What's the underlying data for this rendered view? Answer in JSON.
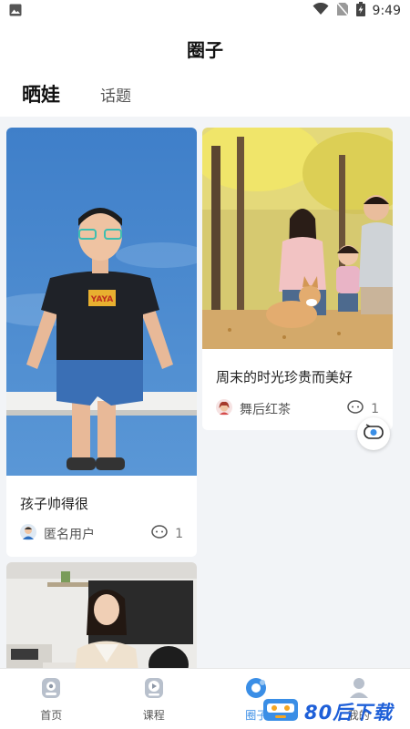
{
  "status_bar": {
    "time": "9:49"
  },
  "header": {
    "title": "圈子"
  },
  "tabs": [
    {
      "label": "晒娃",
      "active": true
    },
    {
      "label": "话题",
      "active": false
    }
  ],
  "posts": [
    {
      "caption": "孩子帅得很",
      "author": "匿名用户",
      "comment_count": "1",
      "shirt_text": "YAYA"
    },
    {
      "caption": "周末的时光珍贵而美好",
      "author": "舞后红茶",
      "comment_count": "1"
    }
  ],
  "bottom_nav": [
    {
      "label": "首页",
      "icon": "home-icon"
    },
    {
      "label": "课程",
      "icon": "course-play-icon"
    },
    {
      "label": "圈子",
      "icon": "circle-icon",
      "active": true
    },
    {
      "label": "我的",
      "icon": "profile-icon"
    }
  ],
  "watermark": {
    "text": "80后下载"
  },
  "colors": {
    "accent": "#3a8ee6",
    "background": "#f2f4f7",
    "watermark": "#1e5fd8"
  }
}
